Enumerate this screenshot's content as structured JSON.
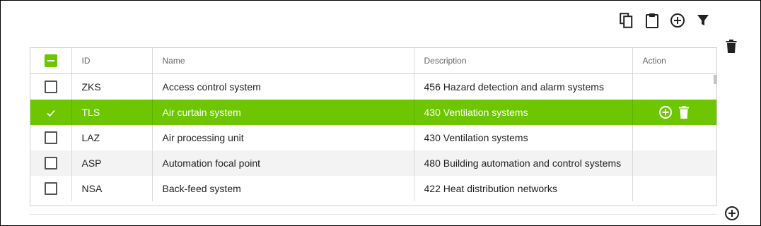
{
  "toolbar": {
    "buttons": [
      {
        "icon": "copy-icon"
      },
      {
        "icon": "clipboard-icon"
      },
      {
        "icon": "add-circle-icon"
      },
      {
        "icon": "filter-icon"
      }
    ]
  },
  "side_actions": {
    "delete_icon": "trash-icon",
    "add_icon": "add-circle-icon"
  },
  "table": {
    "columns": {
      "id": "ID",
      "name": "Name",
      "description": "Description",
      "action": "Action"
    },
    "header_checkbox_state": "indeterminate",
    "rows": [
      {
        "id": "ZKS",
        "name": "Access control system",
        "description": "456 Hazard detection and alarm systems",
        "selected": false
      },
      {
        "id": "TLS",
        "name": "Air curtain system",
        "description": "430 Ventilation systems",
        "selected": true
      },
      {
        "id": "LAZ",
        "name": "Air processing unit",
        "description": "430 Ventilation systems",
        "selected": false
      },
      {
        "id": "ASP",
        "name": "Automation focal point",
        "description": "480 Building automation and control systems",
        "selected": false
      },
      {
        "id": "NSA",
        "name": "Back-feed system",
        "description": "422 Heat distribution networks",
        "selected": false
      }
    ],
    "row_action_icons": [
      "add-circle-icon",
      "trash-icon"
    ]
  },
  "colors": {
    "accent": "#6ec600",
    "alt_row": "#f3f3f3",
    "text": "#222222"
  }
}
